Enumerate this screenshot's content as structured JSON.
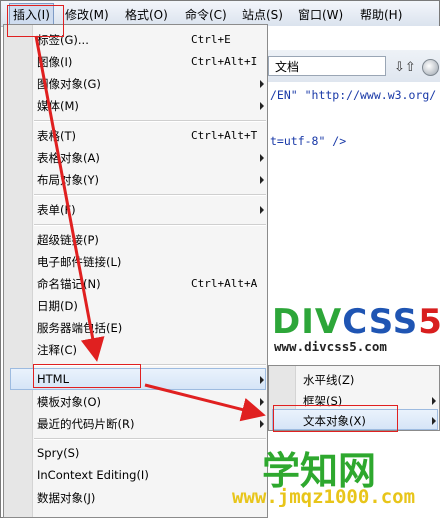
{
  "menubar": {
    "items": [
      {
        "label": "插入(I)"
      },
      {
        "label": "修改(M)"
      },
      {
        "label": "格式(O)"
      },
      {
        "label": "命令(C)"
      },
      {
        "label": "站点(S)"
      },
      {
        "label": "窗口(W)"
      },
      {
        "label": "帮助(H)"
      }
    ]
  },
  "editor": {
    "doc_title": "文档",
    "code_lines": [
      "/EN\" \"http://www.w3.org/",
      "t=utf-8\" />"
    ],
    "logo_parts": [
      "DIV",
      "CSS",
      "5"
    ],
    "logo_url": "www.divcss5.com"
  },
  "insert_menu": {
    "items": [
      {
        "label": "标签(G)...",
        "shortcut": "Ctrl+E"
      },
      {
        "label": "图像(I)",
        "shortcut": "Ctrl+Alt+I"
      },
      {
        "label": "图像对象(G)",
        "shortcut": ""
      },
      {
        "label": "媒体(M)",
        "shortcut": ""
      },
      {
        "label": "表格(T)",
        "shortcut": "Ctrl+Alt+T"
      },
      {
        "label": "表格对象(A)",
        "shortcut": ""
      },
      {
        "label": "布局对象(Y)",
        "shortcut": ""
      },
      {
        "label": "表单(F)",
        "shortcut": ""
      },
      {
        "label": "超级链接(P)",
        "shortcut": ""
      },
      {
        "label": "电子邮件链接(L)",
        "shortcut": ""
      },
      {
        "label": "命名锚记(N)",
        "shortcut": "Ctrl+Alt+A"
      },
      {
        "label": "日期(D)",
        "shortcut": ""
      },
      {
        "label": "服务器端包括(E)",
        "shortcut": ""
      },
      {
        "label": "注释(C)",
        "shortcut": ""
      },
      {
        "label": "HTML",
        "shortcut": ""
      },
      {
        "label": "模板对象(O)",
        "shortcut": ""
      },
      {
        "label": "最近的代码片断(R)",
        "shortcut": ""
      },
      {
        "label": "Spry(S)",
        "shortcut": ""
      },
      {
        "label": "InContext Editing(I)",
        "shortcut": ""
      },
      {
        "label": "数据对象(J)",
        "shortcut": ""
      }
    ]
  },
  "html_submenu": {
    "items": [
      {
        "label": "水平线(Z)"
      },
      {
        "label": "框架(S)"
      },
      {
        "label": "文本对象(X)"
      }
    ]
  },
  "watermark": {
    "title": "学知网",
    "url": "www.jmqz1000.com"
  },
  "colors": {
    "annotation_red": "#e02020",
    "highlight_blue": "#d6e5f7",
    "watermark_green": "#2ea82e",
    "watermark_yellow": "#e8c51a"
  }
}
